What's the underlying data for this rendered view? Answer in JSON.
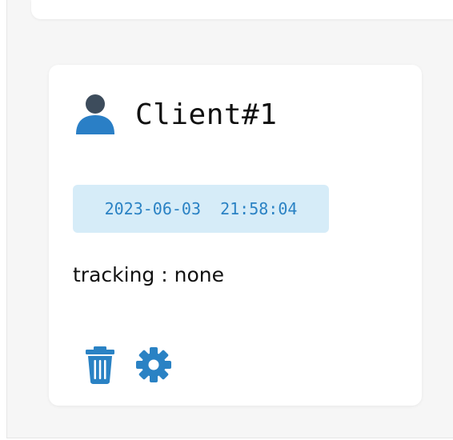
{
  "client": {
    "name": "Client#1",
    "timestamp": "2023-06-03  21:58:04",
    "tracking": "tracking : none"
  },
  "icons": {
    "user": "user-icon",
    "delete": "trash-icon",
    "settings": "gear-icon"
  },
  "colors": {
    "accent": "#2a82c4",
    "badge_bg": "#d6ecf8",
    "user_head": "#3d4c5c",
    "user_body": "#2a7fc6"
  }
}
